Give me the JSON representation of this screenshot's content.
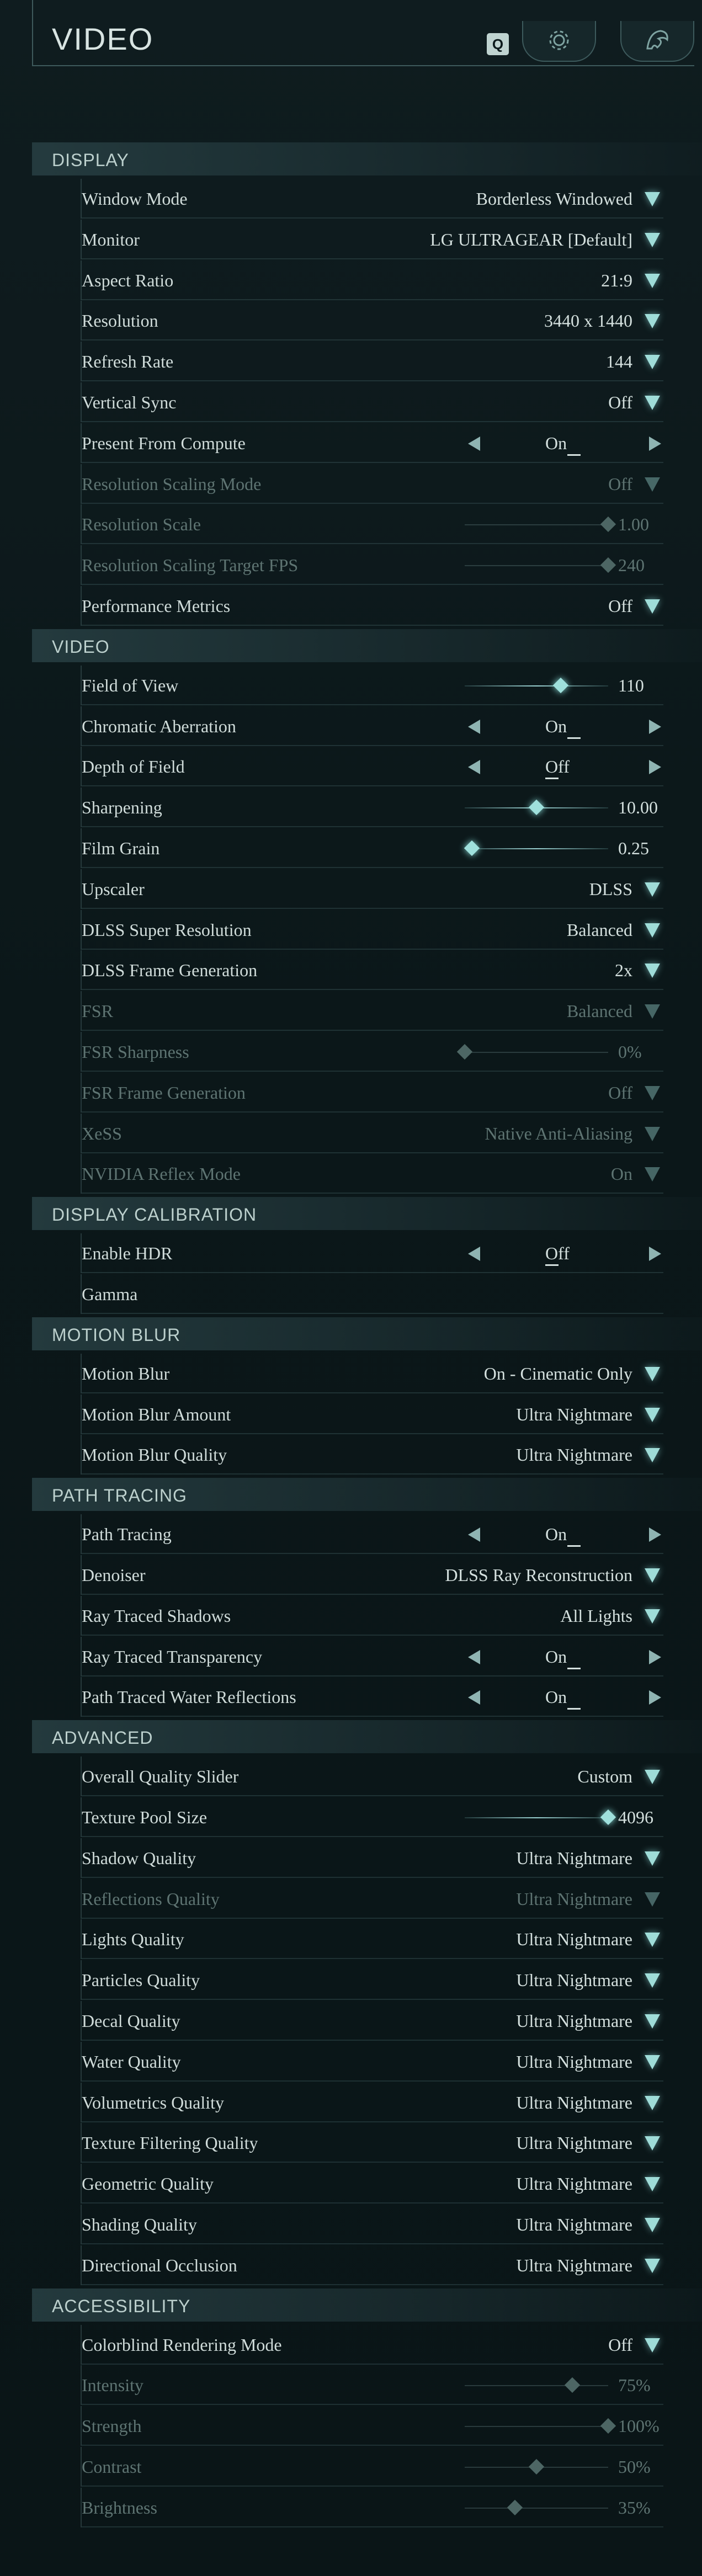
{
  "page_title": "VIDEO",
  "header": {
    "search_key": "Q"
  },
  "sections": [
    {
      "title": "DISPLAY",
      "rows": [
        {
          "label": "Window Mode",
          "kind": "dropdown",
          "value": "Borderless Windowed",
          "enabled": true
        },
        {
          "label": "Monitor",
          "kind": "dropdown",
          "value": "LG ULTRAGEAR [Default]",
          "enabled": true
        },
        {
          "label": "Aspect Ratio",
          "kind": "dropdown",
          "value": "21:9",
          "enabled": true
        },
        {
          "label": "Resolution",
          "kind": "dropdown",
          "value": "3440 x 1440",
          "enabled": true
        },
        {
          "label": "Refresh Rate",
          "kind": "dropdown",
          "value": "144",
          "enabled": true
        },
        {
          "label": "Vertical Sync",
          "kind": "dropdown",
          "value": "Off",
          "enabled": true
        },
        {
          "label": "Present From Compute",
          "kind": "toggle",
          "value": "On",
          "enabled": true
        },
        {
          "label": "Resolution Scaling Mode",
          "kind": "dropdown",
          "value": "Off",
          "enabled": false
        },
        {
          "label": "Resolution Scale",
          "kind": "slider",
          "value": "1.00",
          "fraction": 1.0,
          "enabled": false
        },
        {
          "label": "Resolution Scaling Target FPS",
          "kind": "slider",
          "value": "240",
          "fraction": 1.0,
          "enabled": false
        },
        {
          "label": "Performance Metrics",
          "kind": "dropdown",
          "value": "Off",
          "enabled": true
        }
      ]
    },
    {
      "title": "VIDEO",
      "rows": [
        {
          "label": "Field of View",
          "kind": "slider",
          "value": "110",
          "fraction": 0.67,
          "enabled": true
        },
        {
          "label": "Chromatic Aberration",
          "kind": "toggle",
          "value": "On",
          "enabled": true
        },
        {
          "label": "Depth of Field",
          "kind": "toggle",
          "value": "Off",
          "enabled": true
        },
        {
          "label": "Sharpening",
          "kind": "slider",
          "value": "10.00",
          "fraction": 0.5,
          "enabled": true
        },
        {
          "label": "Film Grain",
          "kind": "slider",
          "value": "0.25",
          "fraction": 0.05,
          "enabled": true
        },
        {
          "label": "Upscaler",
          "kind": "dropdown",
          "value": "DLSS",
          "enabled": true
        },
        {
          "label": "DLSS Super Resolution",
          "kind": "dropdown",
          "value": "Balanced",
          "enabled": true
        },
        {
          "label": "DLSS Frame Generation",
          "kind": "dropdown",
          "value": "2x",
          "enabled": true
        },
        {
          "label": "FSR",
          "kind": "dropdown",
          "value": "Balanced",
          "enabled": false
        },
        {
          "label": "FSR Sharpness",
          "kind": "slider",
          "value": "0%",
          "fraction": 0.0,
          "enabled": false
        },
        {
          "label": "FSR Frame Generation",
          "kind": "dropdown",
          "value": "Off",
          "enabled": false
        },
        {
          "label": "XeSS",
          "kind": "dropdown",
          "value": "Native Anti-Aliasing",
          "enabled": false
        },
        {
          "label": "NVIDIA Reflex Mode",
          "kind": "dropdown",
          "value": "On",
          "enabled": false
        }
      ]
    },
    {
      "title": "DISPLAY CALIBRATION",
      "rows": [
        {
          "label": "Enable HDR",
          "kind": "toggle",
          "value": "Off",
          "enabled": true
        },
        {
          "label": "Gamma",
          "kind": "label",
          "value": "",
          "enabled": true
        }
      ]
    },
    {
      "title": "MOTION BLUR",
      "rows": [
        {
          "label": "Motion Blur",
          "kind": "dropdown",
          "value": "On - Cinematic Only",
          "enabled": true
        },
        {
          "label": "Motion Blur Amount",
          "kind": "dropdown",
          "value": "Ultra Nightmare",
          "enabled": true
        },
        {
          "label": "Motion Blur Quality",
          "kind": "dropdown",
          "value": "Ultra Nightmare",
          "enabled": true
        }
      ]
    },
    {
      "title": "PATH TRACING",
      "rows": [
        {
          "label": "Path Tracing",
          "kind": "toggle",
          "value": "On",
          "enabled": true
        },
        {
          "label": "Denoiser",
          "kind": "dropdown",
          "value": "DLSS Ray Reconstruction",
          "enabled": true
        },
        {
          "label": "Ray Traced Shadows",
          "kind": "dropdown",
          "value": "All Lights",
          "enabled": true
        },
        {
          "label": "Ray Traced Transparency",
          "kind": "toggle",
          "value": "On",
          "enabled": true
        },
        {
          "label": "Path Traced Water Reflections",
          "kind": "toggle",
          "value": "On",
          "enabled": true
        }
      ]
    },
    {
      "title": "ADVANCED",
      "rows": [
        {
          "label": "Overall Quality Slider",
          "kind": "dropdown",
          "value": "Custom",
          "enabled": true
        },
        {
          "label": "Texture Pool Size",
          "kind": "slider",
          "value": "4096",
          "fraction": 1.0,
          "enabled": true
        },
        {
          "label": "Shadow Quality",
          "kind": "dropdown",
          "value": "Ultra Nightmare",
          "enabled": true
        },
        {
          "label": "Reflections Quality",
          "kind": "dropdown",
          "value": "Ultra Nightmare",
          "enabled": false
        },
        {
          "label": "Lights Quality",
          "kind": "dropdown",
          "value": "Ultra Nightmare",
          "enabled": true
        },
        {
          "label": "Particles Quality",
          "kind": "dropdown",
          "value": "Ultra Nightmare",
          "enabled": true
        },
        {
          "label": "Decal Quality",
          "kind": "dropdown",
          "value": "Ultra Nightmare",
          "enabled": true
        },
        {
          "label": "Water Quality",
          "kind": "dropdown",
          "value": "Ultra Nightmare",
          "enabled": true
        },
        {
          "label": "Volumetrics Quality",
          "kind": "dropdown",
          "value": "Ultra Nightmare",
          "enabled": true
        },
        {
          "label": "Texture Filtering Quality",
          "kind": "dropdown",
          "value": "Ultra Nightmare",
          "enabled": true
        },
        {
          "label": "Geometric Quality",
          "kind": "dropdown",
          "value": "Ultra Nightmare",
          "enabled": true
        },
        {
          "label": "Shading Quality",
          "kind": "dropdown",
          "value": "Ultra Nightmare",
          "enabled": true
        },
        {
          "label": "Directional Occlusion",
          "kind": "dropdown",
          "value": "Ultra Nightmare",
          "enabled": true
        }
      ]
    },
    {
      "title": "ACCESSIBILITY",
      "rows": [
        {
          "label": "Colorblind Rendering Mode",
          "kind": "dropdown",
          "value": "Off",
          "enabled": true
        },
        {
          "label": "Intensity",
          "kind": "slider",
          "value": "75%",
          "fraction": 0.75,
          "enabled": false
        },
        {
          "label": "Strength",
          "kind": "slider",
          "value": "100%",
          "fraction": 1.0,
          "enabled": false
        },
        {
          "label": "Contrast",
          "kind": "slider",
          "value": "50%",
          "fraction": 0.5,
          "enabled": false
        },
        {
          "label": "Brightness",
          "kind": "slider",
          "value": "35%",
          "fraction": 0.35,
          "enabled": false
        }
      ]
    }
  ]
}
